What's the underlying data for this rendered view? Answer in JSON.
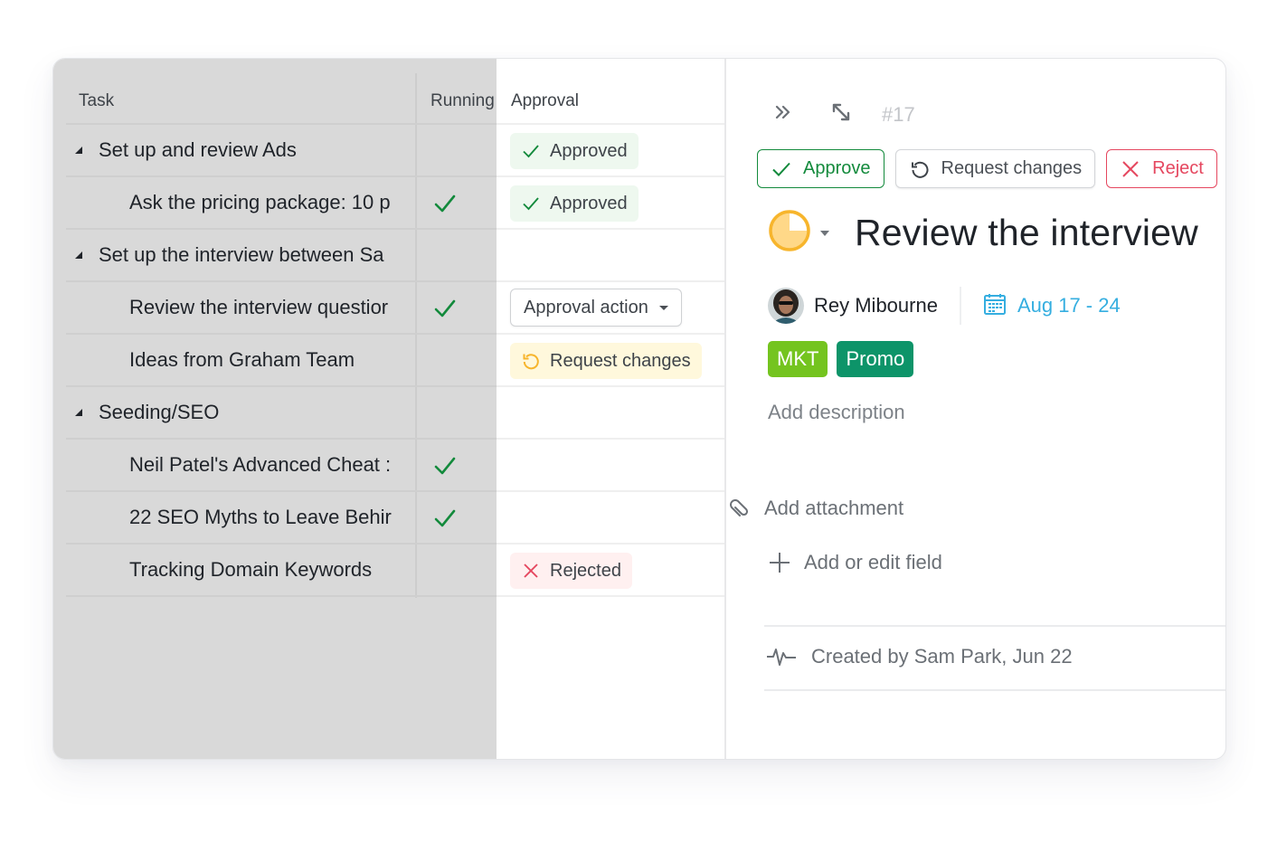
{
  "grid": {
    "columns": {
      "task": "Task",
      "running": "Running",
      "approval": "Approval"
    },
    "rows": [
      {
        "task": "Set up and review Ads",
        "level": "parent",
        "running": false,
        "approval": "Approved"
      },
      {
        "task": "Ask the pricing package: 10 p",
        "level": "child",
        "running": true,
        "approval": "Approved"
      },
      {
        "task": "Set up the interview between Sa",
        "level": "parent",
        "running": false,
        "approval": ""
      },
      {
        "task": "Review the interview questior",
        "level": "child",
        "running": true,
        "approval": "Approval action"
      },
      {
        "task": "Ideas from Graham Team",
        "level": "child",
        "running": false,
        "approval": "Request changes"
      },
      {
        "task": "Seeding/SEO",
        "level": "parent",
        "running": false,
        "approval": ""
      },
      {
        "task": "Neil Patel's Advanced Cheat :",
        "level": "child",
        "running": true,
        "approval": ""
      },
      {
        "task": "22 SEO Myths to Leave Behir",
        "level": "child",
        "running": true,
        "approval": ""
      },
      {
        "task": "Tracking Domain Keywords",
        "level": "child",
        "running": false,
        "approval": "Rejected"
      }
    ],
    "badges": {
      "approved": "Approved",
      "request_changes": "Request changes",
      "rejected": "Rejected",
      "approval_action": "Approval action"
    }
  },
  "panel": {
    "task_id": "#17",
    "actions": {
      "approve": "Approve",
      "request_changes": "Request changes",
      "reject": "Reject"
    },
    "title": "Review the interview",
    "status_progress": 0.75,
    "assignee": "Rey Mibourne",
    "date_range": "Aug 17 - 24",
    "tags": [
      {
        "label": "MKT",
        "color": "#74c41f"
      },
      {
        "label": "Promo",
        "color": "#0d9469"
      }
    ],
    "add_description": "Add description",
    "add_attachment": "Add attachment",
    "add_field": "Add or edit field",
    "created": "Created by Sam Park, Jun 22"
  },
  "colors": {
    "approve": "#138a3c",
    "reject": "#e5475f",
    "warning": "#f7b52c",
    "date": "#35aee0"
  }
}
